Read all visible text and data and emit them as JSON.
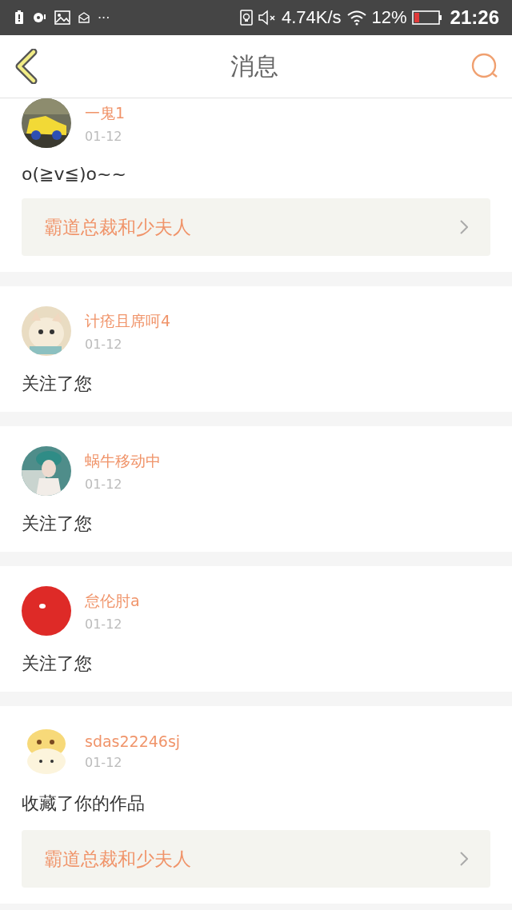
{
  "status_bar": {
    "more": "···",
    "speed": "4.74K/s",
    "battery_text": "12%",
    "time": "21:26"
  },
  "header": {
    "title": "消息"
  },
  "messages": [
    {
      "user": "一鬼1",
      "date": "01-12",
      "text": "o(≧v≦)o~~",
      "work": "霸道总裁和少夫人"
    },
    {
      "user": "计疮且席呵4",
      "date": "01-12",
      "text": "关注了您"
    },
    {
      "user": "蜗牛移动中",
      "date": "01-12",
      "text": "关注了您"
    },
    {
      "user": "怠伦肘a",
      "date": "01-12",
      "text": "关注了您"
    },
    {
      "user": "sdas22246sj",
      "date": "01-12",
      "text": "收藏了你的作品",
      "work": "霸道总裁和少夫人"
    }
  ]
}
